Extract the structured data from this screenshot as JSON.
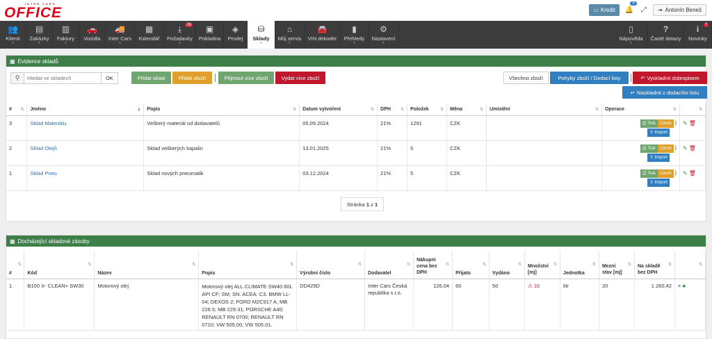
{
  "header": {
    "logo_sub": "INTER CARS",
    "logo_main": "OFFICE",
    "kredit_label": "Kredit",
    "notifications_count": "0",
    "user_name": "Antonín Beneš"
  },
  "nav": {
    "items": [
      {
        "label": "Klienti",
        "icon": "users-icon",
        "glyph": "👥"
      },
      {
        "label": "Zakázky",
        "icon": "list-icon",
        "glyph": "▤"
      },
      {
        "label": "Faktury",
        "icon": "document-icon",
        "glyph": "▥"
      },
      {
        "label": "Vozidla",
        "icon": "car-icon",
        "glyph": "🚗"
      },
      {
        "label": "Inter Cars",
        "icon": "truck-icon",
        "glyph": "🚚"
      },
      {
        "label": "Kalendář",
        "icon": "calendar-icon",
        "glyph": "▦"
      },
      {
        "label": "Požadavky",
        "icon": "download-icon",
        "glyph": "⤓",
        "badge": "26"
      },
      {
        "label": "Pokladna",
        "icon": "cash-icon",
        "glyph": "▣"
      },
      {
        "label": "Prodej",
        "icon": "box-icon",
        "glyph": "◈"
      },
      {
        "label": "Sklady",
        "icon": "warehouse-icon",
        "glyph": "⛁"
      },
      {
        "label": "Můj servis",
        "icon": "home-icon",
        "glyph": "⌂"
      },
      {
        "label": "VIN dekodér",
        "icon": "car-front-icon",
        "glyph": "🚘"
      },
      {
        "label": "Přehledy",
        "icon": "bar-chart-icon",
        "glyph": "▮"
      },
      {
        "label": "Nastavení",
        "icon": "gear-icon",
        "glyph": "⚙"
      }
    ],
    "right_items": [
      {
        "label": "Nápověda",
        "icon": "book-icon",
        "glyph": "▯"
      },
      {
        "label": "Časté dotazy",
        "icon": "question-icon",
        "glyph": "?"
      },
      {
        "label": "Novinky",
        "icon": "info-icon",
        "glyph": "i",
        "badge": "?"
      }
    ]
  },
  "warehouses": {
    "title": "Evidence skladů",
    "search_placeholder": "Hledat ve skladech",
    "ok_label": "OK",
    "buttons": {
      "add_warehouse": "Přidat sklad",
      "add_goods": "Přidat zboží",
      "receive_goods": "Přijmout více zboží",
      "issue_goods": "Vydat více zboží",
      "all_goods": "Všechno zboží",
      "movements": "Pohyby zboží / Dodací listy",
      "write_off_credit": "Vyskladnit dobropisem",
      "stock_from_delivery": "Naskladnit z dodacího listu"
    },
    "columns": [
      "#",
      "Jméno",
      "Popis",
      "Datum vytvoření",
      "DPH",
      "Položek",
      "Měna",
      "Umístění",
      "Operace"
    ],
    "rows": [
      {
        "num": "3",
        "name": "Sklad Materiálu",
        "desc": "Veškerý materiál od dodavatelů",
        "date": "05.09.2024",
        "vat": "21%",
        "items": "1291",
        "currency": "CZK",
        "location": ""
      },
      {
        "num": "2",
        "name": "Sklad Olejů",
        "desc": "Sklad veškerých kapalin",
        "date": "13.01.2025",
        "vat": "21%",
        "items": "5",
        "currency": "CZK",
        "location": ""
      },
      {
        "num": "1",
        "name": "Sklad Pneu",
        "desc": "Sklad nových pneumatik",
        "date": "03.12.2024",
        "vat": "21%",
        "items": "5",
        "currency": "CZK",
        "location": ""
      }
    ],
    "op_labels": {
      "print": "Tisk",
      "pricelist": "Ceník",
      "import": "Import"
    },
    "pager": {
      "prefix": "Stránka",
      "current": "1",
      "sep": "z",
      "total": "1"
    }
  },
  "low_stock": {
    "title": "Docházející skladové zásoby",
    "columns": [
      "#",
      "Kód",
      "Název",
      "Popis",
      "Výrobní číslo",
      "Dodavatel",
      "Nákupní cena bez DPH",
      "Přijato",
      "Vydáno",
      "Množství [mj]",
      "Jednotka",
      "Mezní stav [mj]",
      "Na skladě bez DPH"
    ],
    "rows": [
      {
        "num": "1",
        "code": "B100 X- CLEAN+ SW30",
        "name": "Motorový olej",
        "desc": "Motorový olej ALL CLIMATE SW40 60L API CF; SM; SN. ACEA: C3. BMW LL-04; DEXOS 2; FORD M2C917 A; MB 226.5; MB 229.31; PORSCHE A40; RENAULT RN 0700; RENAULT RN 0710; VW 505.00; VW 505.01.",
        "serial": "DD429D",
        "supplier": "Inter Cars Česká republika s.r.o.",
        "price": "126,04",
        "received": "60",
        "issued": "50",
        "qty": "10",
        "unit": "litr",
        "limit": "20",
        "stock_value": "1 260,42"
      }
    ]
  }
}
